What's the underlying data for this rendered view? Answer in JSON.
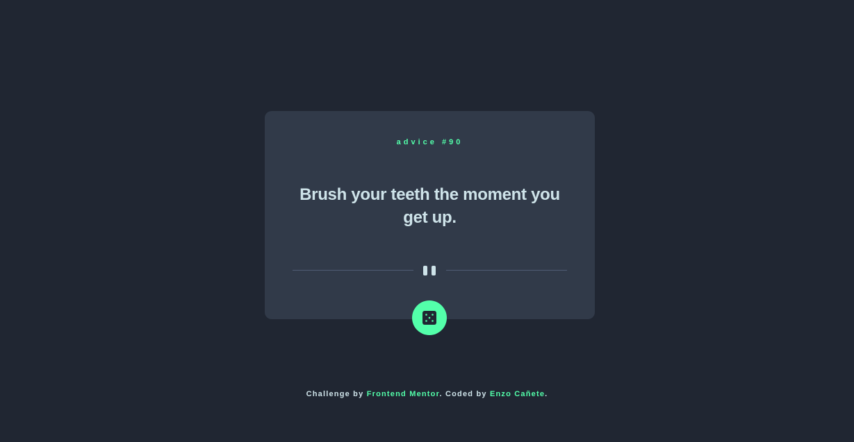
{
  "card": {
    "advice_label": "advice",
    "advice_number": "90",
    "advice_text": "Brush your teeth the moment you get up."
  },
  "dice_button": {
    "icon": "dice-icon"
  },
  "attribution": {
    "challenge_prefix": "Challenge by ",
    "challenge_link": "Frontend Mentor",
    "coded_prefix": ". Coded by ",
    "author_link": "Enzo Cañete",
    "suffix": "."
  },
  "colors": {
    "background": "#202632",
    "card": "#313a49",
    "accent": "#53ffaa",
    "text": "#cee3e9",
    "divider": "#4f5d74"
  }
}
